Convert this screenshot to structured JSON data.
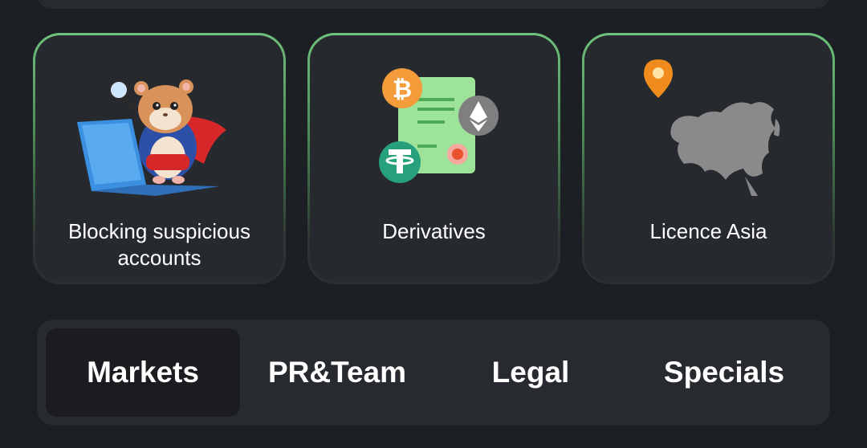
{
  "cards": [
    {
      "label": "Blocking suspicious accounts",
      "icon": "hamster-laptop-icon"
    },
    {
      "label": "Derivatives",
      "icon": "crypto-document-icon"
    },
    {
      "label": "Licence Asia",
      "icon": "asia-map-pin-icon"
    }
  ],
  "tabs": [
    {
      "label": "Markets",
      "active": true
    },
    {
      "label": "PR&Team",
      "active": false
    },
    {
      "label": "Legal",
      "active": false
    },
    {
      "label": "Specials",
      "active": false
    }
  ],
  "colors": {
    "background": "#1c1f24",
    "card": "#26292e",
    "card_border": "#6fc27c",
    "tab_bar": "#272a2f",
    "tab_active": "#1a1c20"
  }
}
